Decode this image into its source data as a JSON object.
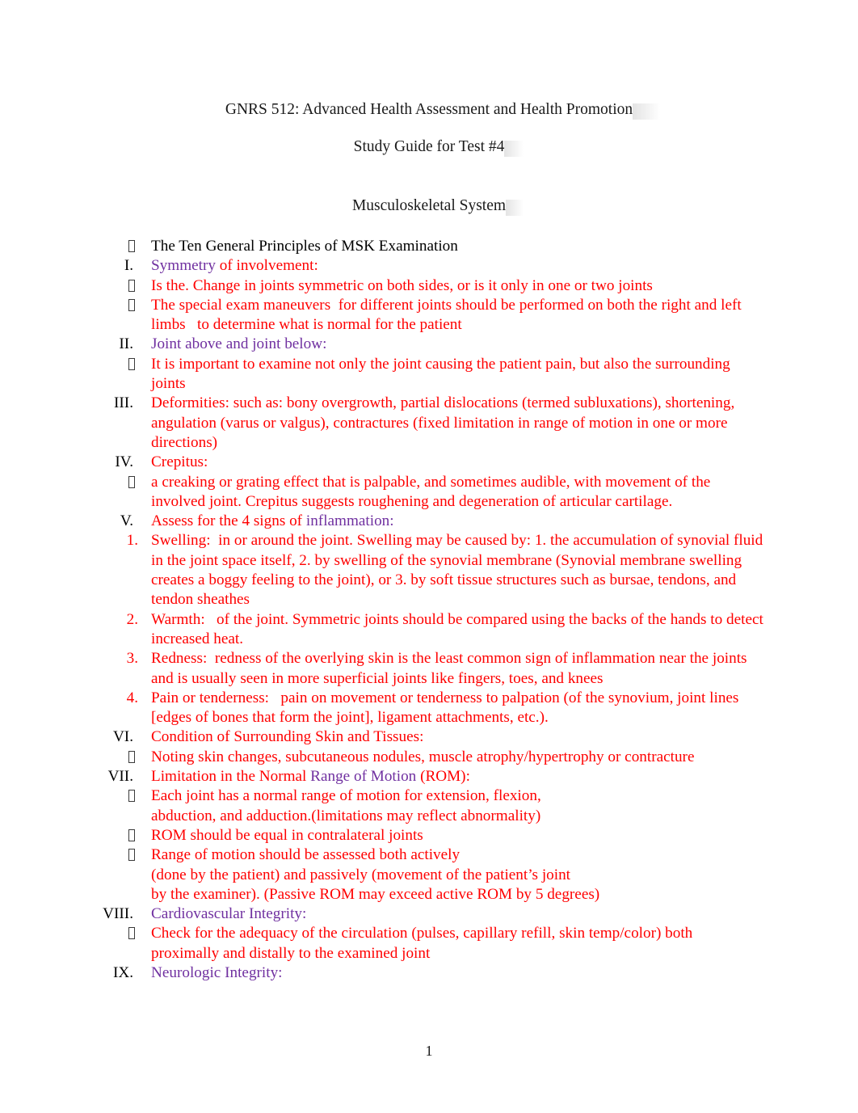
{
  "document": {
    "course_title": "GNRS 512: Advanced Health Assessment and Health Promotion",
    "study_guide_title": "Study Guide for Test #4",
    "system_title": "Musculoskeletal System",
    "page_number": "1"
  },
  "colors": {
    "red": "#FF0000",
    "purple": "#7030A0",
    "black": "#000000"
  },
  "outline": [
    {
      "marker": "",
      "level": "bullet",
      "segments": [
        {
          "text": "The Ten General Principles of MSK Examination",
          "color": "black"
        }
      ]
    },
    {
      "marker": "I.",
      "level": "roman",
      "segments": [
        {
          "text": "Symmetry",
          "color": "purple"
        },
        {
          "text": " of involvement:",
          "color": "red"
        }
      ]
    },
    {
      "marker": "",
      "level": "bullet",
      "segments": [
        {
          "text": "Is the. Change in joints symmetric on both sides, or is it only in one or two joints",
          "color": "red"
        }
      ]
    },
    {
      "marker": "",
      "level": "bullet",
      "segments": [
        {
          "text": "The special exam maneuvers  for different joints should be performed on both the right and left limbs   to determine what is normal for the patient",
          "color": "red"
        }
      ]
    },
    {
      "marker": "II.",
      "level": "roman",
      "segments": [
        {
          "text": "Joint above and joint below:",
          "color": "purple"
        }
      ]
    },
    {
      "marker": "",
      "level": "bullet",
      "segments": [
        {
          "text": "It is important to examine not only the joint causing the patient pain, but also the surrounding joints",
          "color": "red"
        }
      ]
    },
    {
      "marker": "III.",
      "level": "roman",
      "segments": [
        {
          "text": "Deformities: such as: bony overgrowth, partial dislocations (termed subluxations), shortening, angulation (varus or valgus), contractures (fixed limitation in range of motion in one or more directions)",
          "color": "red"
        }
      ]
    },
    {
      "marker": "IV.",
      "level": "roman",
      "segments": [
        {
          "text": "Crepitus:",
          "color": "red"
        }
      ]
    },
    {
      "marker": "",
      "level": "bullet",
      "segments": [
        {
          "text": "a creaking or grating effect that is palpable, and sometimes audible, with movement of the involved joint. Crepitus suggests roughening and degeneration of articular cartilage.",
          "color": "red"
        }
      ]
    },
    {
      "marker": "V.",
      "level": "roman",
      "segments": [
        {
          "text": "Assess for the 4 signs of ",
          "color": "red"
        },
        {
          "text": "inflammation:",
          "color": "purple"
        }
      ]
    },
    {
      "marker": "1.",
      "level": "num",
      "segments": [
        {
          "text": "Swelling:  in or around the joint. Swelling may be caused by: 1. the accumulation of synovial fluid in the joint space itself, 2. by swelling of the synovial membrane (Synovial membrane swelling creates a boggy feeling to the joint), or 3. by soft tissue structures such as bursae, tendons, and tendon sheathes",
          "color": "red"
        }
      ]
    },
    {
      "marker": "2.",
      "level": "num",
      "segments": [
        {
          "text": "Warmth:   of the joint. Symmetric joints should be compared using the backs of the hands to detect increased heat.",
          "color": "red"
        }
      ]
    },
    {
      "marker": "3.",
      "level": "num",
      "segments": [
        {
          "text": "Redness:  redness of the overlying skin is the least common sign of inflammation near the joints and is usually seen in more superficial joints like fingers, toes, and knees",
          "color": "red"
        }
      ]
    },
    {
      "marker": "4.",
      "level": "num",
      "segments": [
        {
          "text": "Pain or tenderness:   pain on movement or tenderness to palpation (of the synovium, joint lines [edges of bones that form the joint], ligament attachments, etc.).",
          "color": "red"
        }
      ]
    },
    {
      "marker": "VI.",
      "level": "roman",
      "segments": [
        {
          "text": "Condition of Surrounding Skin and Tissues:",
          "color": "red"
        }
      ]
    },
    {
      "marker": "",
      "level": "bullet",
      "segments": [
        {
          "text": "Noting skin changes, subcutaneous nodules, muscle atrophy/hypertrophy or contracture",
          "color": "red"
        }
      ]
    },
    {
      "marker": "VII.",
      "level": "roman",
      "segments": [
        {
          "text": "Limitation in the Normal ",
          "color": "red"
        },
        {
          "text": "Range of Motion",
          "color": "purple"
        },
        {
          "text": " (ROM):",
          "color": "red"
        }
      ]
    },
    {
      "marker": "",
      "level": "bullet",
      "segments": [
        {
          "text": "Each joint has a normal range of motion for extension, flexion,\nabduction, and adduction.(limitations may reflect abnormality)",
          "color": "red"
        }
      ]
    },
    {
      "marker": "",
      "level": "bullet",
      "segments": [
        {
          "text": "ROM should be equal in contralateral joints",
          "color": "red"
        }
      ]
    },
    {
      "marker": "",
      "level": "bullet",
      "segments": [
        {
          "text": "Range of motion should be assessed both actively\n(done by the patient) and passively (movement of the patient’s joint\nby the examiner). (Passive ROM may exceed active ROM by 5 degrees)",
          "color": "red"
        }
      ]
    },
    {
      "marker": "VIII.",
      "level": "roman",
      "segments": [
        {
          "text": "Cardiovascular Integrity:",
          "color": "purple"
        }
      ]
    },
    {
      "marker": "",
      "level": "bullet",
      "segments": [
        {
          "text": "Check for the adequacy of the circulation (pulses, capillary refill, skin temp/color) both proximally and distally to the examined joint",
          "color": "red"
        }
      ]
    },
    {
      "marker": "IX.",
      "level": "roman",
      "segments": [
        {
          "text": "Neurologic Integrity:",
          "color": "purple"
        }
      ]
    }
  ]
}
